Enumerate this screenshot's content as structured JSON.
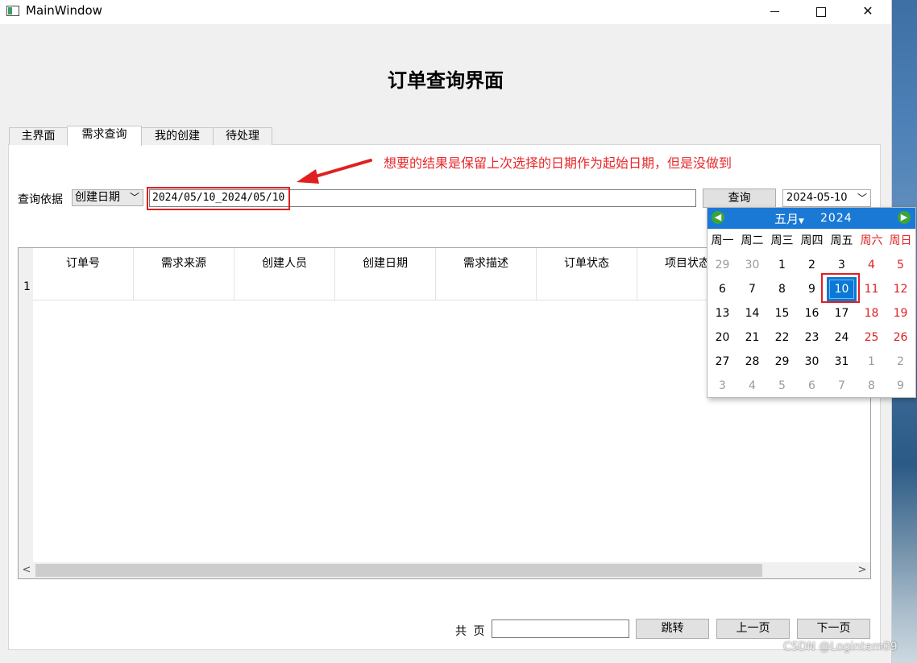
{
  "window": {
    "title": "MainWindow",
    "minimize": "—",
    "maximize": "☐",
    "close": "✕"
  },
  "heading": "订单查询界面",
  "tabs": [
    "主界面",
    "需求查询",
    "我的创建",
    "待处理"
  ],
  "annotation": "想要的结果是保留上次选择的日期作为起始日期，但是没做到",
  "query": {
    "basis_label": "查询依据",
    "basis_value": "创建日期",
    "range_value": "2024/05/10_2024/05/10",
    "query_button": "查询",
    "date_value": "2024-05-10"
  },
  "table": {
    "columns": [
      "订单号",
      "需求来源",
      "创建人员",
      "创建日期",
      "需求描述",
      "订单状态",
      "项目状态"
    ],
    "row_numbers": [
      "1"
    ]
  },
  "pager": {
    "total_label": "共 页",
    "jump": "跳转",
    "prev": "上一页",
    "next": "下一页"
  },
  "calendar": {
    "month": "五月",
    "year": "2024",
    "dow": [
      "周一",
      "周二",
      "周三",
      "周四",
      "周五",
      "周六",
      "周日"
    ],
    "weeks": [
      [
        "29",
        "30",
        "1",
        "2",
        "3",
        "4",
        "5"
      ],
      [
        "6",
        "7",
        "8",
        "9",
        "10",
        "11",
        "12"
      ],
      [
        "13",
        "14",
        "15",
        "16",
        "17",
        "18",
        "19"
      ],
      [
        "20",
        "21",
        "22",
        "23",
        "24",
        "25",
        "26"
      ],
      [
        "27",
        "28",
        "29",
        "30",
        "31",
        "1",
        "2"
      ],
      [
        "3",
        "4",
        "5",
        "6",
        "7",
        "8",
        "9"
      ]
    ],
    "selected": "10",
    "colors": {
      "header": "#1a79d5",
      "weekend": "#e02020",
      "arrow": "#3aa63a"
    }
  },
  "watermark": "CSDN @Logintem09",
  "colors": {
    "annotation": "#e8282b",
    "highlight_box": "#e02020"
  }
}
